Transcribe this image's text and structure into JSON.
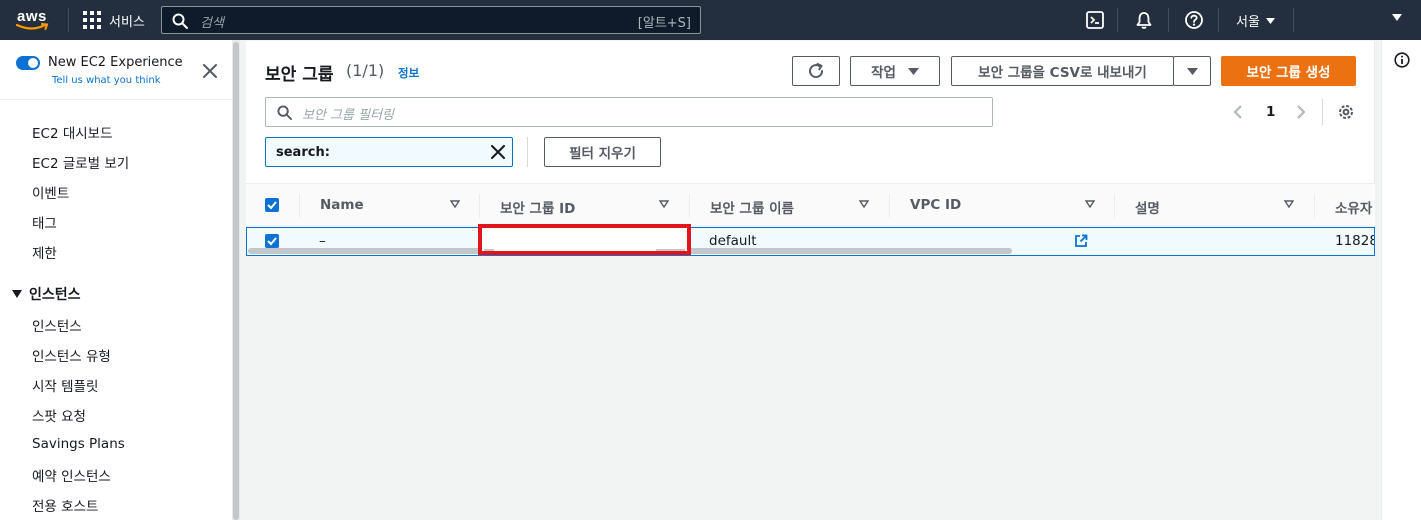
{
  "topnav": {
    "logo_text": "aws",
    "services_label": "서비스",
    "search_placeholder": "검색",
    "search_shortcut": "[알트+S]",
    "region": "서울"
  },
  "sidebar": {
    "experience_title": "New EC2 Experience",
    "experience_link": "Tell us what you think",
    "items_top": [
      "EC2 대시보드",
      "EC2 글로벌 보기",
      "이벤트",
      "태그",
      "제한"
    ],
    "section_instances": "인스턴스",
    "items_instances": [
      "인스턴스",
      "인스턴스 유형",
      "시작 템플릿",
      "스팟 요청",
      "Savings Plans",
      "예약 인스턴스",
      "전용 호스트"
    ]
  },
  "panel": {
    "title": "보안 그룹",
    "count": "(1/1)",
    "info_link": "정보",
    "actions_label": "작업",
    "export_label": "보안 그룹을 CSV로 내보내기",
    "create_label": "보안 그룹 생성",
    "filter_placeholder": "보안 그룹 필터링",
    "page_number": "1",
    "token_label": "search:",
    "clear_filters_label": "필터 지우기"
  },
  "table": {
    "columns": [
      "Name",
      "보안 그룹 ID",
      "보안 그룹 이름",
      "VPC ID",
      "설명",
      "소유자"
    ],
    "row": {
      "name": "–",
      "security_group_id": "",
      "security_group_name": "default",
      "vpc_id": "",
      "description": "",
      "owner": "11828"
    }
  },
  "colors": {
    "nav_bg": "#232f3e",
    "accent_blue": "#0972d3",
    "primary_orange": "#ec7211",
    "redaction_red": "#e1131b"
  }
}
